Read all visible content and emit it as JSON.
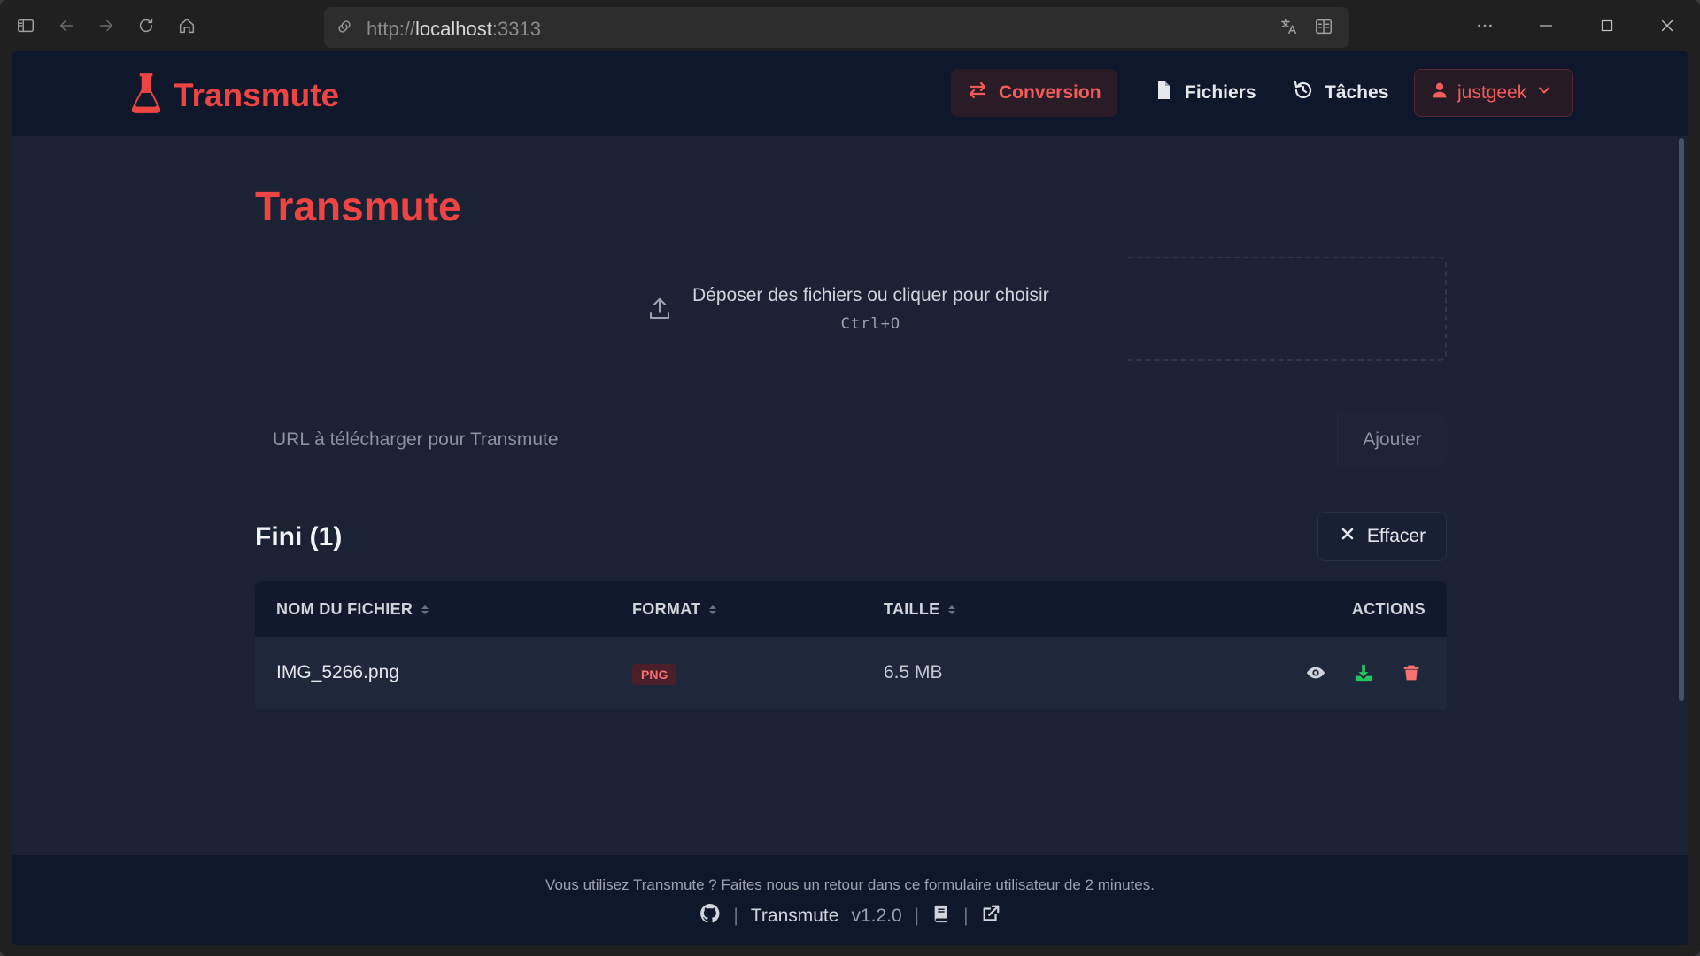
{
  "browser": {
    "url_prefix": "http://",
    "url_host": "localhost",
    "url_port": ":3313"
  },
  "nav": {
    "brand": "Transmute",
    "links": [
      {
        "label": "Conversion",
        "icon": "arrows-exchange-icon",
        "active": true
      },
      {
        "label": "Fichiers",
        "icon": "file-icon",
        "active": false
      },
      {
        "label": "Tâches",
        "icon": "history-icon",
        "active": false
      }
    ],
    "user": "justgeek"
  },
  "main": {
    "title": "Transmute",
    "dropzone": {
      "text": "Déposer des fichiers ou cliquer pour choisir",
      "shortcut": "Ctrl+O"
    },
    "url_input": {
      "placeholder": "URL à télécharger pour Transmute",
      "value": ""
    },
    "add_label": "Ajouter",
    "section_title": "Fini (1)",
    "clear_label": "Effacer",
    "table": {
      "headers": [
        "NOM DU FICHIER",
        "FORMAT",
        "TAILLE",
        "ACTIONS"
      ],
      "rows": [
        {
          "name": "IMG_5266.png",
          "format": "PNG",
          "size": "6.5 MB"
        }
      ]
    }
  },
  "footer": {
    "note": "Vous utilisez Transmute ? Faites nous un retour dans ce formulaire utilisateur de 2 minutes.",
    "app": "Transmute",
    "version": "v1.2.0",
    "separator": "|"
  },
  "colors": {
    "accent": "#ef4444",
    "bg": "#1a2233",
    "nav_bg": "#0f172a",
    "download": "#22c55e",
    "delete": "#f87171"
  }
}
